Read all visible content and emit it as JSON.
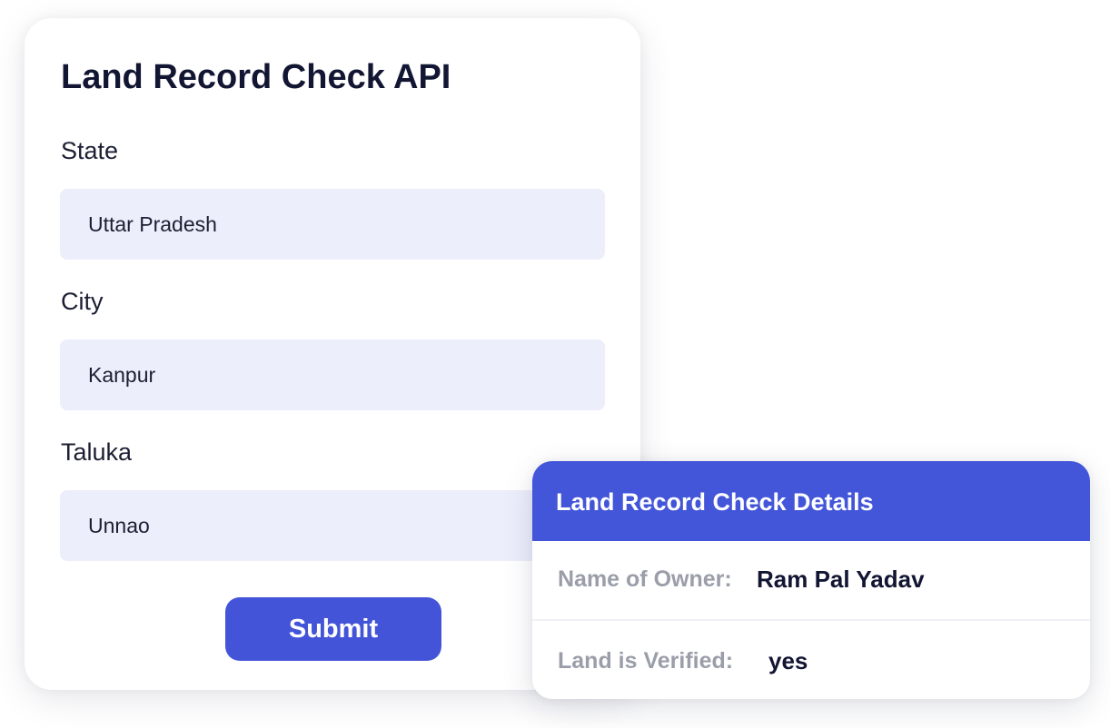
{
  "form": {
    "title": "Land Record Check API",
    "fields": [
      {
        "label": "State",
        "value": "Uttar Pradesh"
      },
      {
        "label": "City",
        "value": "Kanpur"
      },
      {
        "label": "Taluka",
        "value": "Unnao"
      }
    ],
    "submit_label": "Submit"
  },
  "details": {
    "title": "Land Record Check Details",
    "rows": [
      {
        "label": "Name of Owner:",
        "value": "Ram Pal Yadav"
      },
      {
        "label": "Land is Verified:",
        "value": "yes"
      }
    ]
  },
  "colors": {
    "accent": "#4354d8",
    "input_background": "#eceefb",
    "label_muted": "#9a9ea9"
  }
}
